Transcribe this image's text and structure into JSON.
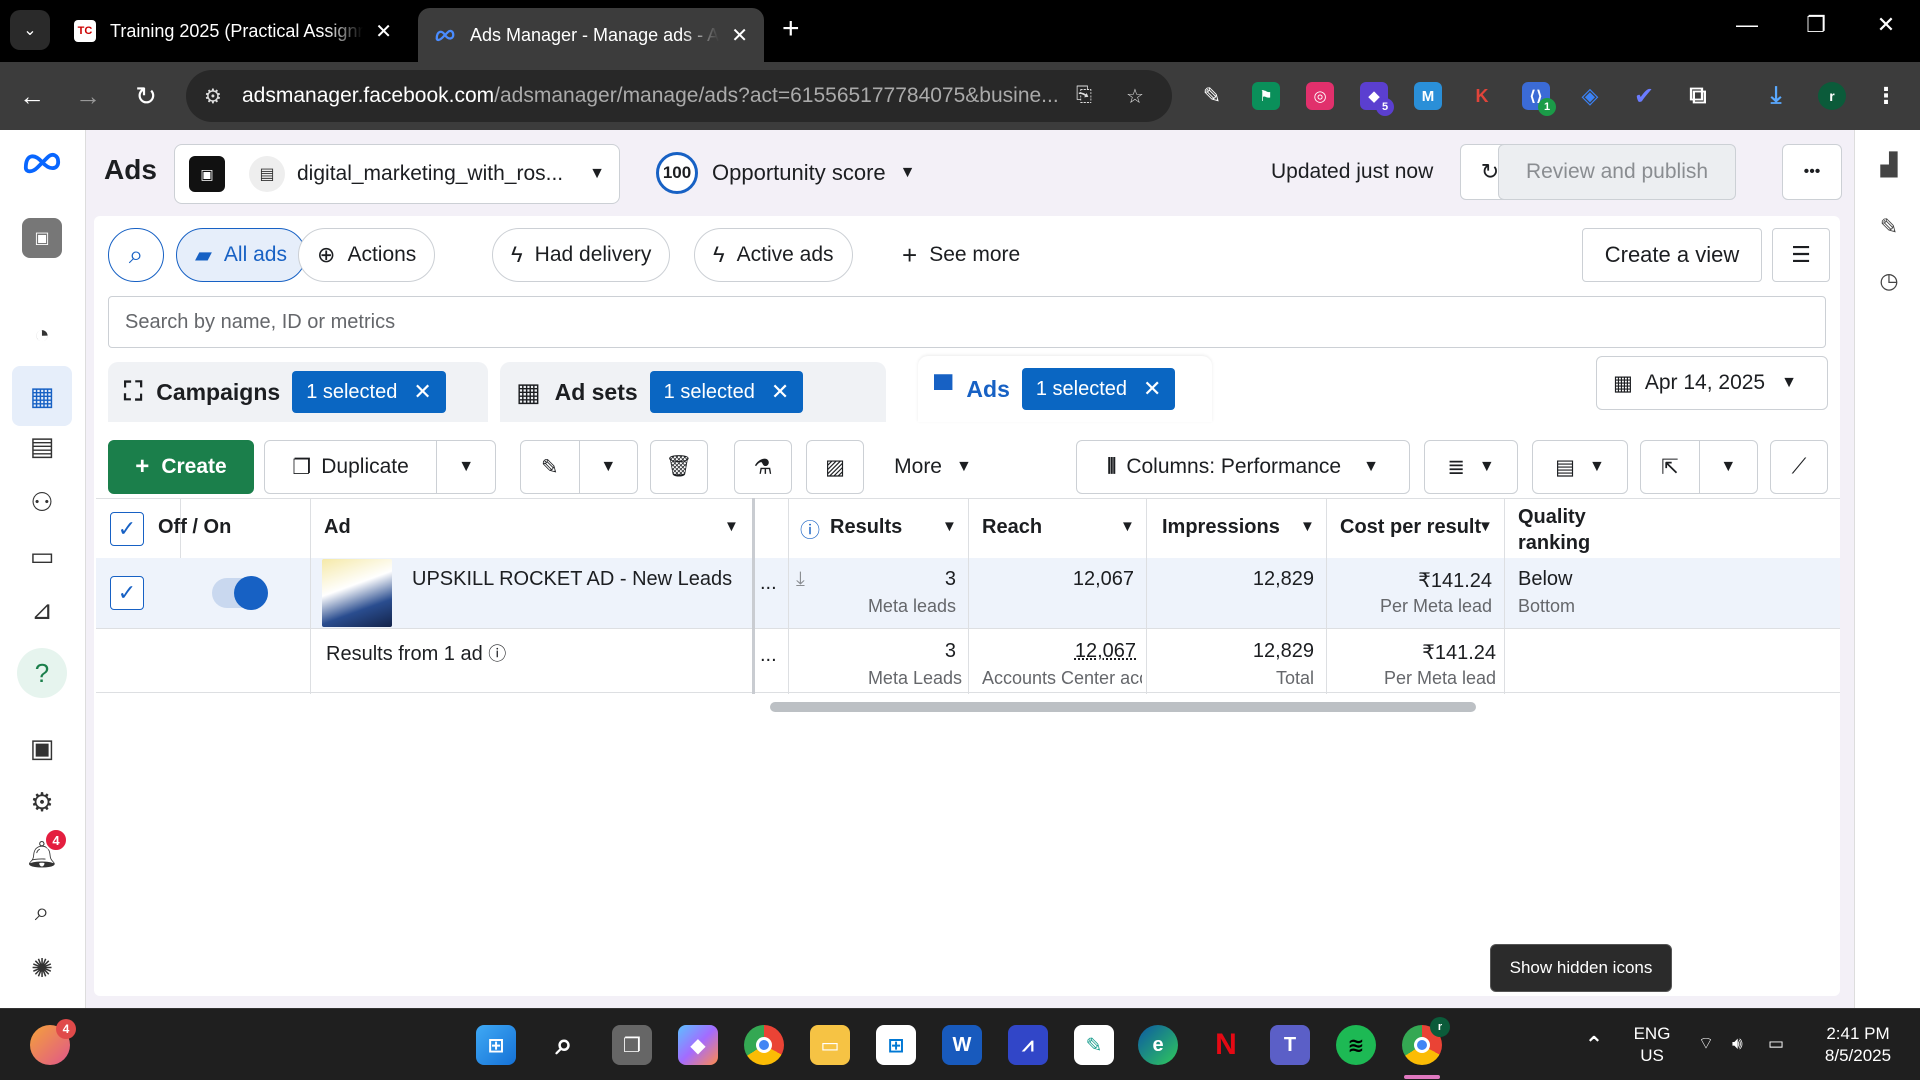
{
  "browser": {
    "tabs": [
      {
        "title": "Training 2025 (Practical Assignm",
        "favicon": "TC"
      },
      {
        "title": "Ads Manager - Manage ads - A",
        "favicon": "meta-icon"
      }
    ],
    "new_tab": "+",
    "url_domain": "adsmanager.facebook.com",
    "url_path": "/adsmanager/manage/ads?act=615565177784075&busine...",
    "profile_initial": "r",
    "extension_badges": {
      "ext4": "5",
      "ext8": "1"
    }
  },
  "leftnav": {
    "notification_count": "4",
    "items": [
      "meta-logo",
      "account-icon",
      "dashboard-icon",
      "table-icon",
      "reports-icon",
      "audiences-icon",
      "billing-icon",
      "campaign-icon",
      "help-icon",
      "pages-icon",
      "settings-icon",
      "notifications-icon",
      "search-icon",
      "bug-icon"
    ]
  },
  "header": {
    "title": "Ads",
    "account_name": "digital_marketing_with_ros...",
    "opportunity_score": "100",
    "opportunity_label": "Opportunity score",
    "updated": "Updated just now",
    "review_publish": "Review and publish",
    "more": "•••"
  },
  "filters": {
    "all_ads": "All ads",
    "actions": "Actions",
    "had_delivery": "Had delivery",
    "active_ads": "Active ads",
    "see_more": "See more",
    "create_view": "Create a view",
    "search_placeholder": "Search by name, ID or metrics"
  },
  "levels": {
    "campaigns": {
      "label": "Campaigns",
      "chip": "1 selected"
    },
    "adsets": {
      "label": "Ad sets",
      "chip": "1 selected"
    },
    "ads": {
      "label": "Ads",
      "chip": "1 selected"
    },
    "date": "Apr 14, 2025"
  },
  "toolbar": {
    "create": "Create",
    "duplicate": "Duplicate",
    "more": "More",
    "columns": "Columns: Performance"
  },
  "table": {
    "headers": {
      "offon": "Off / On",
      "ad": "Ad",
      "results": "Results",
      "reach": "Reach",
      "impressions": "Impressions",
      "cost": "Cost per result",
      "quality": "Quality ranking"
    },
    "row": {
      "name": "UPSKILL ROCKET AD - New Leads",
      "ellipsis": "...",
      "results": "3",
      "results_sub": "Meta leads",
      "reach": "12,067",
      "impressions": "12,829",
      "cost": "₹141.24",
      "cost_sub": "Per Meta lead",
      "quality": "Below",
      "quality_sub": "Bottom"
    },
    "summary": {
      "label": "Results from 1 ad",
      "ellipsis": "...",
      "results": "3",
      "results_sub": "Meta Leads",
      "reach": "12,067",
      "reach_sub": "Accounts Center accou...",
      "impressions": "12,829",
      "impressions_sub": "Total",
      "cost": "₹141.24",
      "cost_sub": "Per Meta lead"
    }
  },
  "tooltip": "Show hidden icons",
  "taskbar": {
    "copilot_badge": "4",
    "lang_top": "ENG",
    "lang_bottom": "US",
    "time": "2:41 PM",
    "date": "8/5/2025",
    "chrome_profile": "r"
  }
}
